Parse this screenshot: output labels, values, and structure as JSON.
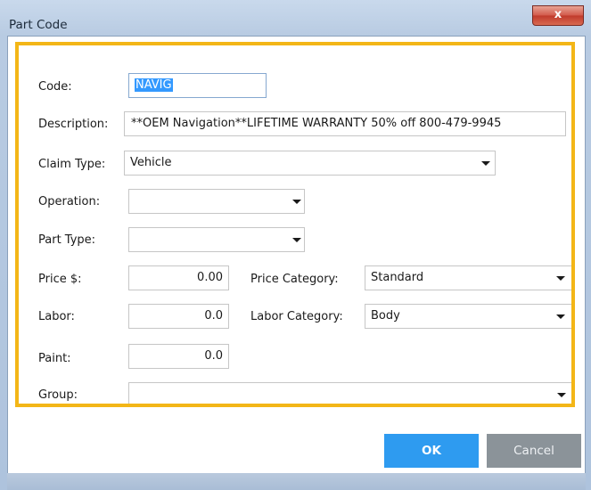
{
  "window": {
    "title": "Part Code",
    "close_glyph": "x"
  },
  "form": {
    "code": {
      "label": "Code:",
      "value": "NAVIG"
    },
    "description": {
      "label": "Description:",
      "value": "**OEM Navigation**LIFETIME WARRANTY 50% off 800-479-9945"
    },
    "claim_type": {
      "label": "Claim Type:",
      "value": "Vehicle"
    },
    "operation": {
      "label": "Operation:",
      "value": ""
    },
    "part_type": {
      "label": "Part Type:",
      "value": ""
    },
    "price": {
      "label": "Price $:",
      "value": "0.00"
    },
    "price_category": {
      "label": "Price Category:",
      "value": "Standard"
    },
    "labor": {
      "label": "Labor:",
      "value": "0.0"
    },
    "labor_category": {
      "label": "Labor Category:",
      "value": "Body"
    },
    "paint": {
      "label": "Paint:",
      "value": "0.0"
    },
    "group": {
      "label": "Group:",
      "value": ""
    }
  },
  "buttons": {
    "ok": "OK",
    "cancel": "Cancel"
  },
  "colors": {
    "highlight": "#f3b617",
    "ok_button": "#2e9bf0",
    "cancel_button": "#8b9399",
    "selection": "#3399ff"
  }
}
